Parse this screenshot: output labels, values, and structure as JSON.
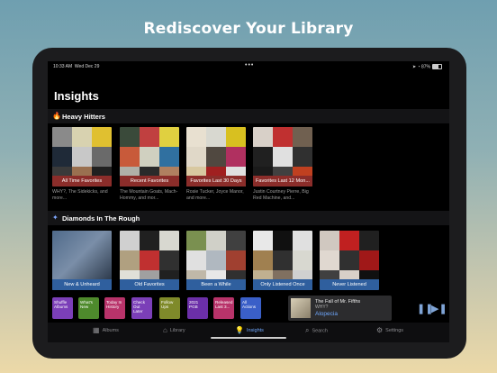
{
  "headline": "Rediscover Your Library",
  "status": {
    "time": "10:33 AM",
    "date": "Wed Dec 29",
    "battery": "87%"
  },
  "page_title": "Insights",
  "sections": [
    {
      "title": "Heavy Hitters",
      "cards": [
        {
          "label": "All Time Favorites",
          "subtitle": "WHY?, The Sidekicks, and more...",
          "color": "#8b2d2a"
        },
        {
          "label": "Recent Favorites",
          "subtitle": "The Mountain Goats, Mach-Hommy, and mor...",
          "color": "#8b2d2a"
        },
        {
          "label": "Favorites Last 30 Days",
          "subtitle": "Rosie Tucker, Joyce Manor, and more...",
          "color": "#8b2d2a"
        },
        {
          "label": "Favorites Last 12 Mon...",
          "subtitle": "Justin Courtney Pierre, Big Red Machine, and...",
          "color": "#8b2d2a"
        }
      ]
    },
    {
      "title": "Diamonds In The Rough",
      "cards": [
        {
          "label": "New & Unheard",
          "color": "#2f5f9e"
        },
        {
          "label": "Old Favorites",
          "color": "#2f5f9e"
        },
        {
          "label": "Been a While",
          "color": "#2f5f9e"
        },
        {
          "label": "Only Listened Once",
          "color": "#2f5f9e"
        },
        {
          "label": "Never Listened",
          "color": "#2f5f9e"
        }
      ]
    }
  ],
  "shortcuts": [
    {
      "label": "Shuffle Albums",
      "color": "#7b3fb8"
    },
    {
      "label": "What's New",
      "color": "#4e8a2c"
    },
    {
      "label": "Today In History",
      "color": "#b8336a"
    },
    {
      "label": "Check Out Later",
      "color": "#7b3fb8"
    },
    {
      "label": "Follow Ups",
      "color": "#7f8a2a"
    },
    {
      "label": "2021 PGB",
      "color": "#6b2fa8"
    },
    {
      "label": "Released Last 3...",
      "color": "#b8336a"
    },
    {
      "label": "All Actions",
      "color": "#3a5fc8"
    }
  ],
  "now_playing": {
    "title": "The Fall of Mr. Fifths",
    "artist": "WHY?",
    "album": "Alopecia"
  },
  "tabs": [
    {
      "label": "Albums",
      "icon": "grid-icon"
    },
    {
      "label": "Library",
      "icon": "building-icon"
    },
    {
      "label": "Insights",
      "icon": "lightbulb-icon"
    },
    {
      "label": "Search",
      "icon": "search-icon"
    },
    {
      "label": "Settings",
      "icon": "gear-icon"
    }
  ]
}
